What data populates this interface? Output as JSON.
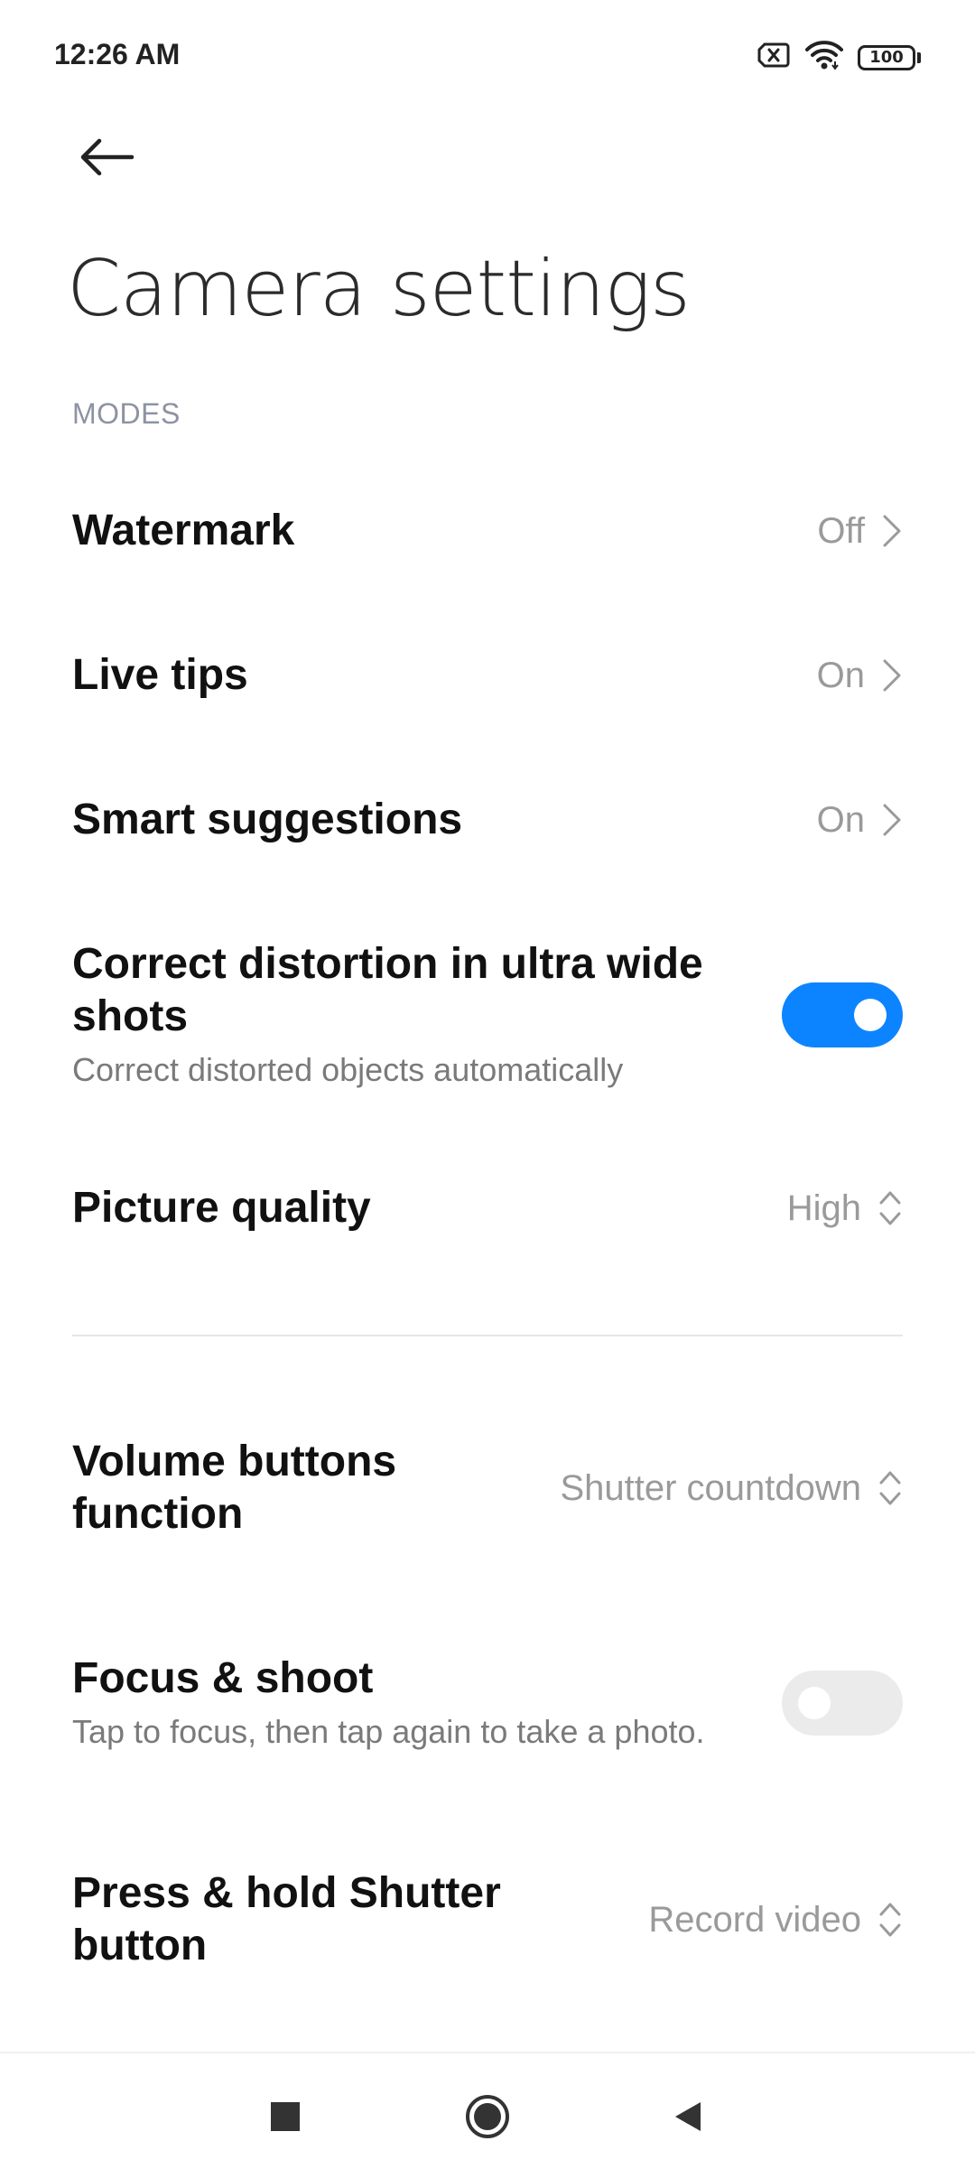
{
  "status_bar": {
    "time": "12:26 AM",
    "battery": "100"
  },
  "header": {
    "title": "Camera settings"
  },
  "section": {
    "label": "MODES"
  },
  "rows": [
    {
      "title": "Watermark",
      "value": "Off"
    },
    {
      "title": "Live tips",
      "value": "On"
    },
    {
      "title": "Smart suggestions",
      "value": "On"
    },
    {
      "title": "Correct distortion in ultra wide shots",
      "subtitle": "Correct distorted objects automatically",
      "toggle": true
    },
    {
      "title": "Picture quality",
      "value": "High"
    },
    {
      "title": "Volume buttons function",
      "value": "Shutter countdown"
    },
    {
      "title": "Focus & shoot",
      "subtitle": "Tap to focus, then tap again to take a photo.",
      "toggle": false
    },
    {
      "title": "Press & hold Shutter button",
      "value": "Record video"
    }
  ],
  "colors": {
    "toggle_on": "#0d84ff",
    "toggle_off": "#ebebeb",
    "value_text": "#9a9a9a",
    "section_text": "#8c93a3"
  },
  "icons": {
    "back": "arrow-left-icon",
    "chevron": "chevron-right-icon",
    "updown": "chevron-up-down-icon",
    "nav_recents": "square-icon",
    "nav_home": "circle-icon",
    "nav_back": "triangle-left-icon"
  }
}
